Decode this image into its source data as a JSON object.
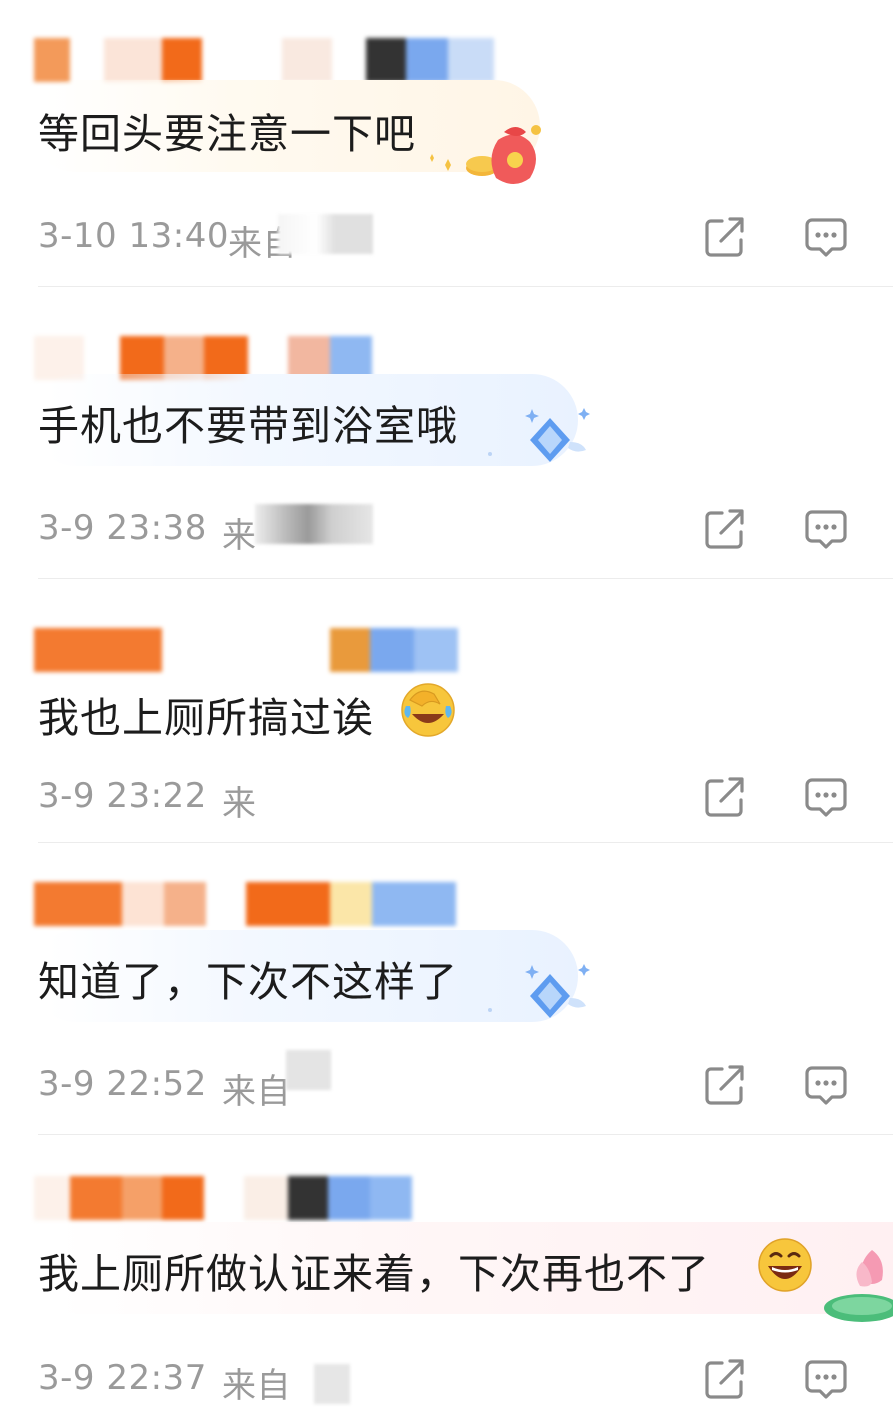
{
  "comments": [
    {
      "text": "等回头要注意一下吧",
      "time": "3-10 13:40",
      "source": "来自",
      "decoration": "lucky-bag-icon"
    },
    {
      "text": "手机也不要带到浴室哦",
      "time": "3-9 23:38",
      "source": "来",
      "decoration": "diamond-badge-icon"
    },
    {
      "text": "我也上厕所搞过诶",
      "time": "3-9 23:22",
      "source": "来",
      "decoration": "facepalm-laugh-emoji"
    },
    {
      "text": "知道了，下次不这样了",
      "time": "3-9 22:52",
      "source": "来自",
      "decoration": "diamond-badge-icon"
    },
    {
      "text": "我上厕所做认证来着，下次再也不了",
      "time": "3-9 22:37",
      "source": "来自",
      "decoration": "grinning-emoji"
    }
  ],
  "actions": {
    "share_icon": "share-icon",
    "reply_icon": "comment-icon"
  },
  "colors": {
    "name_orange": "#f07020",
    "name_blue": "#8fb8f2",
    "meta_gray": "#9a9a9a",
    "icon_gray": "#8a8a8a"
  }
}
